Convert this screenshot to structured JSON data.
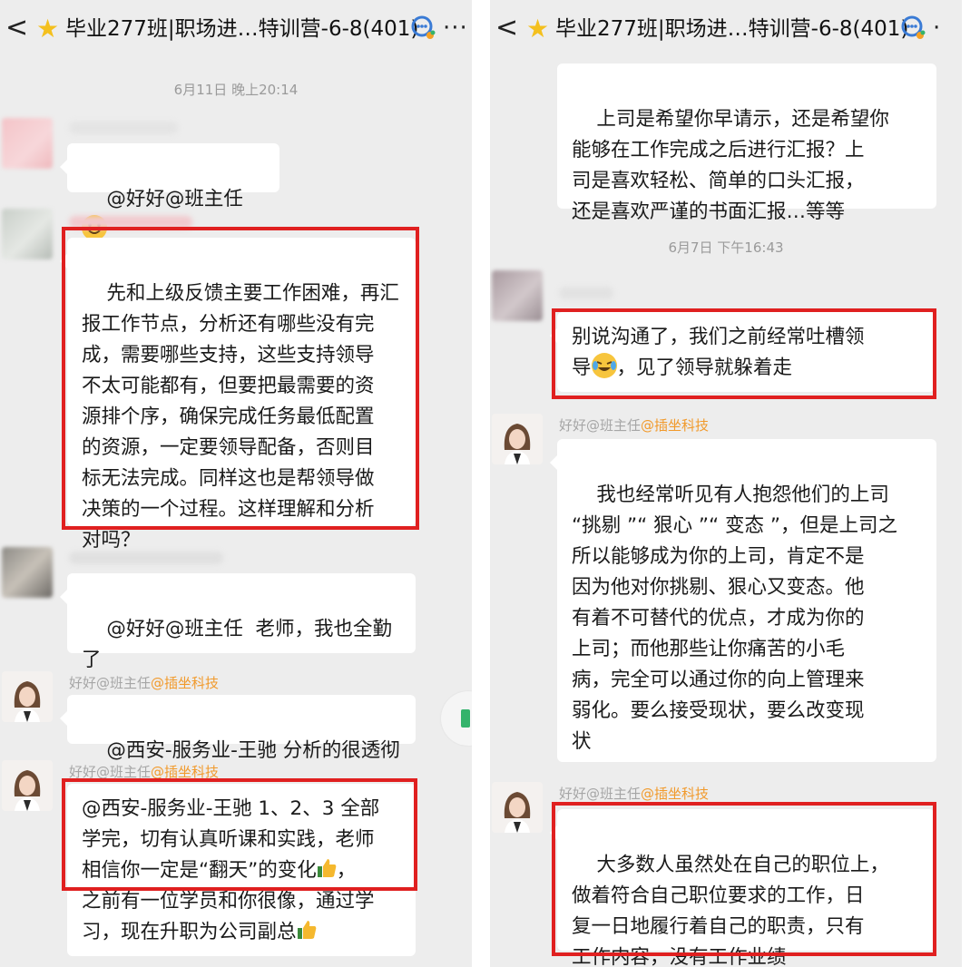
{
  "left": {
    "header": {
      "back": "<",
      "title": "毕业277班|职场进…特训营-6-8(401)",
      "more": "···"
    },
    "timestamp": "6月11日 晚上20:14",
    "msg1": {
      "text": "@好好@班主任 "
    },
    "msg2": {
      "text": "先和上级反馈主要工作困难，再汇\n报工作节点，分析还有哪些没有完\n成，需要哪些支持，这些支持领导\n不太可能都有，但要把最需要的资\n源排个序，确保完成任务最低配置\n的资源，一定要领导配备，否则目\n标无法完成。同样这也是帮领导做\n决策的一个过程。这样理解和分析\n对吗？"
    },
    "msg3": {
      "text": "@好好@班主任  老师，我也全勤\n了"
    },
    "msg4": {
      "sender": "好好@班主任",
      "org": "@插坐科技",
      "text": "@西安-服务业-王驰 分析的很透彻"
    },
    "msg5": {
      "sender": "好好@班主任",
      "org": "@插坐科技",
      "line1": "@西安-服务业-王驰 1、2、3 全部",
      "line2": "学完，切有认真听课和实践，老师",
      "line3": "相信你一定是“翻天”的变化",
      "line3b": "，",
      "line4": "之前有一位学员和你很像，通过学",
      "line5": "习，现在升职为公司副总"
    }
  },
  "right": {
    "header": {
      "back": "<",
      "title": "毕业277班|职场进…特训营-6-8(401)",
      "more": "·"
    },
    "msg0": {
      "text": "上司是希望你早请示，还是希望你\n能够在工作完成之后进行汇报？上\n司是喜欢轻松、简单的口头汇报，\n还是喜欢严谨的书面汇报…等等"
    },
    "timestamp": "6月7日 下午16:43",
    "msg1": {
      "line1": "别说沟通了，我们之前经常吐槽领",
      "line2a": "导",
      "line2b": "，见了领导就躲着走"
    },
    "msg2": {
      "sender": "好好@班主任",
      "org": "@插坐科技",
      "text": "我也经常听见有人抱怨他们的上司\n“挑剔 ”“ 狠心 ”“ 变态 ”，但是上司之\n所以能够成为你的上司，肯定不是\n因为他对你挑剔、狠心又变态。他\n有着不可替代的优点，才成为你的\n上司；而他那些让你痛苦的小毛\n病，完全可以通过你的向上管理来\n弱化。要么接受现状，要么改变现\n状"
    },
    "msg3": {
      "sender": "好好@班主任",
      "org": "@插坐科技",
      "text": "大多数人虽然处在自己的职位上，\n做着符合自己职位要求的工作，日\n复一日地履行着自己的职责，只有\n工作内容，没有工作业绩"
    }
  },
  "colors": {
    "highlight": "#e02020",
    "org": "#f19a2c",
    "background": "#ededed"
  },
  "icons": [
    "back-arrow-icon",
    "star-icon",
    "group-chat-icon",
    "more-icon",
    "smile-emoji-icon",
    "laugh-cry-emoji-icon",
    "thumbs-up-icon"
  ]
}
